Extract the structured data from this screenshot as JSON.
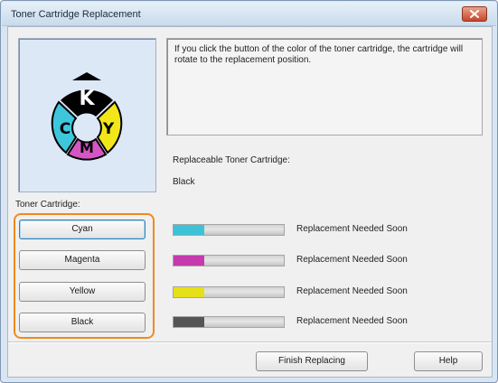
{
  "window": {
    "title": "Toner Cartridge Replacement",
    "close_icon": "close-icon"
  },
  "wheel": {
    "segments": [
      {
        "letter": "K",
        "color": "#000000",
        "text_color": "#ffffff"
      },
      {
        "letter": "C",
        "color": "#3ec6dd",
        "text_color": "#000000"
      },
      {
        "letter": "Y",
        "color": "#f2e61a",
        "text_color": "#000000"
      },
      {
        "letter": "M",
        "color": "#d655c4",
        "text_color": "#000000"
      }
    ]
  },
  "message": "If you click the button of the color of the toner cartridge, the cartridge will rotate to the replacement position.",
  "replaceable": {
    "label": "Replaceable Toner Cartridge:",
    "value": "Black"
  },
  "toner_cartridge_label": "Toner Cartridge:",
  "cartridges": [
    {
      "button": "Cyan",
      "color": "#3cc3d8",
      "level": 0.28,
      "status": "Replacement Needed Soon"
    },
    {
      "button": "Magenta",
      "color": "#c53aad",
      "level": 0.28,
      "status": "Replacement Needed Soon"
    },
    {
      "button": "Yellow",
      "color": "#e6e018",
      "level": 0.28,
      "status": "Replacement Needed Soon"
    },
    {
      "button": "Black",
      "color": "#555555",
      "level": 0.28,
      "status": "Replacement Needed Soon"
    }
  ],
  "footer": {
    "finish_label": "Finish Replacing",
    "help_label": "Help"
  },
  "colors": {
    "highlight": "#f08a1e",
    "window_frame": "#d9e6f2"
  }
}
